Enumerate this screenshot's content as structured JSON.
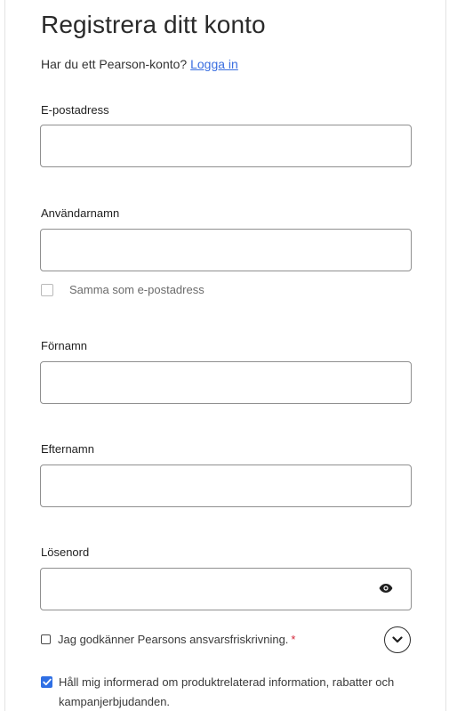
{
  "form": {
    "title": "Registrera ditt konto",
    "signin_prompt": "Har du ett Pearson-konto?",
    "signin_link": "Logga in",
    "email": {
      "label": "E-postadress",
      "value": ""
    },
    "username": {
      "label": "Användarnamn",
      "value": ""
    },
    "same_as_email": {
      "label": "Samma som e-postadress",
      "checked": false
    },
    "first_name": {
      "label": "Förnamn",
      "value": ""
    },
    "last_name": {
      "label": "Efternamn",
      "value": ""
    },
    "password": {
      "label": "Lösenord",
      "value": "",
      "toggle_icon": "eye-icon"
    },
    "terms": {
      "label": "Jag godkänner Pearsons ansvarsfriskrivning.",
      "required_marker": "*",
      "checked": false,
      "expand_icon": "chevron-down-icon"
    },
    "marketing": {
      "label": "Håll mig informerad om produktrelaterad information, rabatter och kampanjerbjudanden.",
      "checked": true
    }
  },
  "colors": {
    "link": "#3a6ee0",
    "checkbox_checked": "#2f6fe4",
    "required": "#d3263a",
    "input_border": "#8f8f8f"
  }
}
